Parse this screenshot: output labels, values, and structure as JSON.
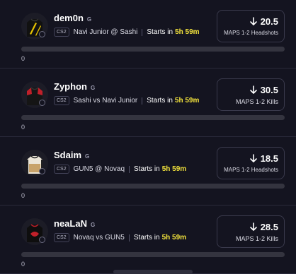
{
  "cards": [
    {
      "name": "dem0n",
      "position": "G",
      "league": "CS2",
      "matchup": "Navi Junior @ Sashi",
      "starts_label": "Starts in",
      "starts_time": "5h 59m",
      "line": "20.5",
      "direction_icon": "arrow-down-icon",
      "stat": "MAPS 1-2 Headshots",
      "progress": 0,
      "count": "0",
      "jersey_primary": "#111111",
      "jersey_accent": "#e5c100"
    },
    {
      "name": "Zyphon",
      "position": "G",
      "league": "CS2",
      "matchup": "Sashi vs Navi Junior",
      "starts_label": "Starts in",
      "starts_time": "5h 59m",
      "line": "30.5",
      "direction_icon": "arrow-down-icon",
      "stat": "MAPS 1-2 Kills",
      "progress": 0,
      "count": "0",
      "jersey_primary": "#151515",
      "jersey_accent": "#c0202a"
    },
    {
      "name": "Sdaim",
      "position": "G",
      "league": "CS2",
      "matchup": "GUN5 @ Novaq",
      "starts_label": "Starts in",
      "starts_time": "5h 59m",
      "line": "18.5",
      "direction_icon": "arrow-down-icon",
      "stat": "MAPS 1-2 Headshots",
      "progress": 0,
      "count": "0",
      "jersey_primary": "#ece6d8",
      "jersey_accent": "#c8a36a"
    },
    {
      "name": "neaLaN",
      "position": "G",
      "league": "CS2",
      "matchup": "Novaq vs GUN5",
      "starts_label": "Starts in",
      "starts_time": "5h 59m",
      "line": "28.5",
      "direction_icon": "arrow-down-icon",
      "stat": "MAPS 1-2 Kills",
      "progress": 0,
      "count": "0",
      "jersey_primary": "#0e0e0e",
      "jersey_accent": "#c0202a"
    }
  ],
  "colors": {
    "background": "#141420",
    "starts_time": "#f2e23c",
    "divider": "#2a2a3a"
  }
}
